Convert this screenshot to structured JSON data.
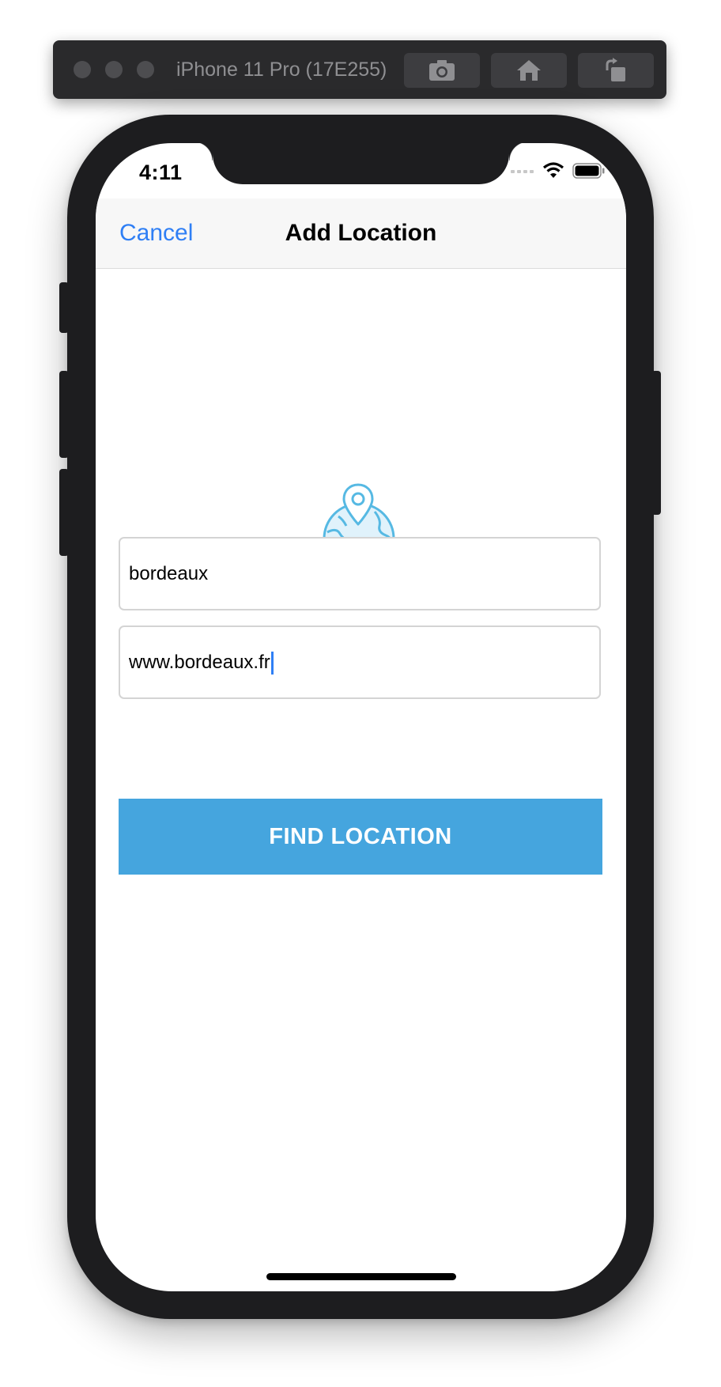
{
  "simulator": {
    "title": "iPhone 11 Pro (17E255)",
    "buttons": [
      "screenshot-icon",
      "home-icon",
      "rotate-icon"
    ]
  },
  "status_bar": {
    "time": "4:11",
    "icons": [
      "cellular-icon",
      "wifi-icon",
      "battery-icon"
    ]
  },
  "nav": {
    "cancel_label": "Cancel",
    "title": "Add Location"
  },
  "form": {
    "location_value": "bordeaux",
    "link_value": "www.bordeaux.fr",
    "submit_label": "FIND LOCATION"
  },
  "colors": {
    "accent": "#2f7ff5",
    "button": "#45a5de",
    "icon": "#56b9e3"
  }
}
